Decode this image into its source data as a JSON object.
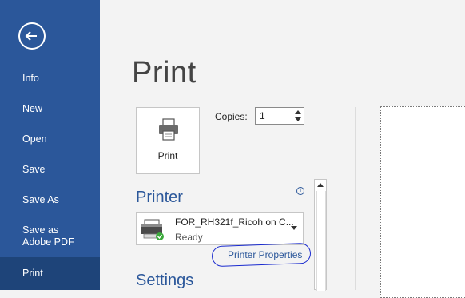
{
  "sidebar": {
    "back_icon": "back-arrow-icon",
    "items": [
      {
        "label": "Info"
      },
      {
        "label": "New"
      },
      {
        "label": "Open"
      },
      {
        "label": "Save"
      },
      {
        "label": "Save As"
      },
      {
        "label": "Save as Adobe PDF"
      },
      {
        "label": "Print",
        "selected": true
      }
    ],
    "colors": {
      "background": "#2b579a",
      "selected": "#1e4479"
    }
  },
  "main": {
    "title": "Print",
    "print_button": {
      "label": "Print",
      "icon": "printer-icon"
    },
    "copies": {
      "label": "Copies:",
      "value": "1"
    },
    "printer_section": {
      "heading": "Printer",
      "info_icon": "info-icon",
      "selected_printer": {
        "name": "FOR_RH321f_Ricoh on C...",
        "status": "Ready",
        "icon": "printer-device-icon"
      },
      "properties_link": "Printer Properties"
    },
    "settings_section": {
      "heading": "Settings"
    }
  }
}
